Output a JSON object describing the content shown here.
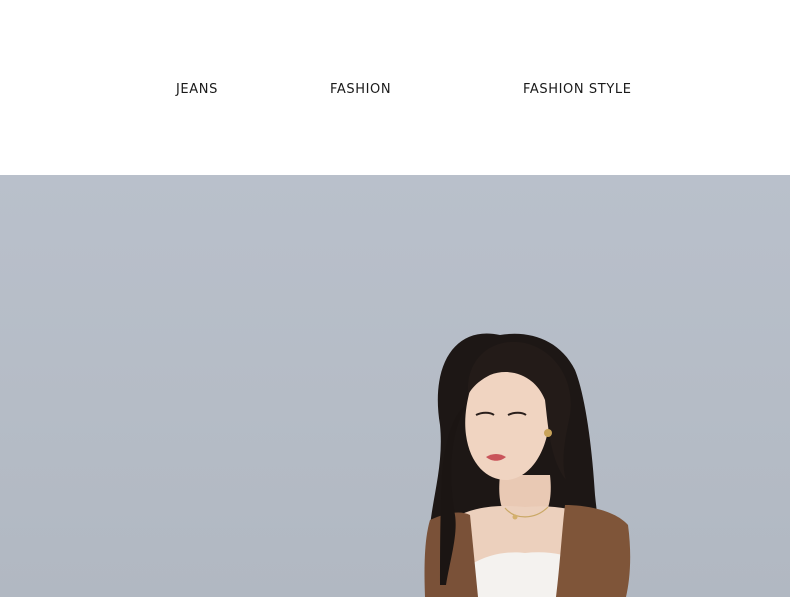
{
  "header": {
    "labels": [
      "JEANS",
      "FASHION",
      "FASHION STYLE"
    ]
  },
  "hero": {
    "background_color": "#b6bdc7",
    "photo_subject": "woman with long wavy dark hair wearing a brown suede vest over a white ribbed top"
  }
}
